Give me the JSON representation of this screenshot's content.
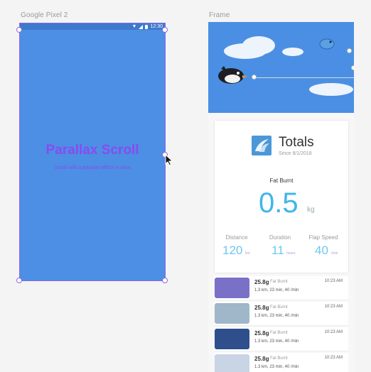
{
  "artboards": {
    "pixel_label": "Google Pixel 2",
    "frame_label": "Frame"
  },
  "pixel": {
    "status_time": "12:30",
    "title": "Parallax Scroll",
    "subtitle": "Scroll with a parallax effect in view"
  },
  "totals": {
    "title": "Totals",
    "since": "Since 8/1/2018",
    "fat_label": "Fat Burnt",
    "fat_value": "0.5",
    "fat_unit": "kg",
    "stats": [
      {
        "label": "Distance",
        "value": "120",
        "unit": "km"
      },
      {
        "label": "Duration",
        "value": "11",
        "unit": "hours"
      },
      {
        "label": "Flap Speed",
        "value": "40",
        "unit": "/min"
      }
    ]
  },
  "entries": [
    {
      "grams": "25.8g",
      "sub": "Fat Burnt",
      "detail": "1.3 km, 23 min, 40 /min",
      "time": "10:23 AM",
      "thumb": "#7a70c8"
    },
    {
      "grams": "25.8g",
      "sub": "Fat Burnt",
      "detail": "1.3 km, 23 min, 40 /min",
      "time": "10:23 AM",
      "thumb": "#9fb7c8"
    },
    {
      "grams": "25.8g",
      "sub": "Fat Burnt",
      "detail": "1.3 km, 23 min, 40 /min",
      "time": "10:23 AM",
      "thumb": "#2e4f8c"
    },
    {
      "grams": "25.8g",
      "sub": "Fat Burnt",
      "detail": "1.3 km, 23 min, 40 /min",
      "time": "10:23 AM",
      "thumb": "#c9d4e4"
    }
  ],
  "colors": {
    "accent": "#8a68e8",
    "sky": "#4a8fe3",
    "value_blue": "#3fb6ea"
  }
}
